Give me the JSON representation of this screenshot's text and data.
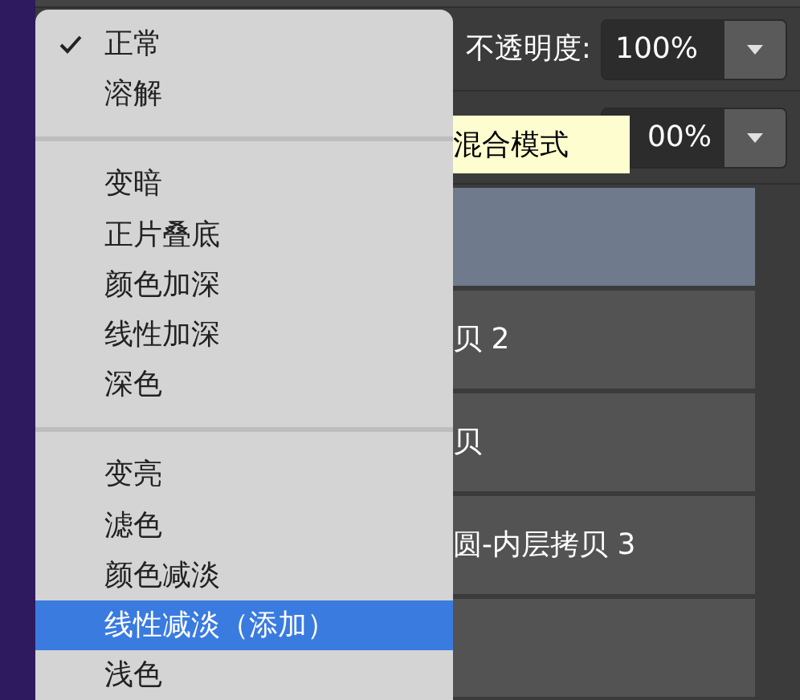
{
  "blend_menu": {
    "groups": [
      {
        "items": [
          {
            "label": "正常",
            "checked": true,
            "selected": false
          },
          {
            "label": "溶解",
            "checked": false,
            "selected": false
          }
        ]
      },
      {
        "items": [
          {
            "label": "变暗",
            "checked": false,
            "selected": false
          },
          {
            "label": "正片叠底",
            "checked": false,
            "selected": false
          },
          {
            "label": "颜色加深",
            "checked": false,
            "selected": false
          },
          {
            "label": "线性加深",
            "checked": false,
            "selected": false
          },
          {
            "label": "深色",
            "checked": false,
            "selected": false
          }
        ]
      },
      {
        "items": [
          {
            "label": "变亮",
            "checked": false,
            "selected": false
          },
          {
            "label": "滤色",
            "checked": false,
            "selected": false
          },
          {
            "label": "颜色减淡",
            "checked": false,
            "selected": false
          },
          {
            "label": "线性减淡（添加）",
            "checked": false,
            "selected": true
          },
          {
            "label": "浅色",
            "checked": false,
            "selected": false
          }
        ]
      }
    ]
  },
  "opacity": {
    "label": "不透明度:",
    "value": "100%"
  },
  "tooltip": "混合模式",
  "fill": {
    "value": "00%"
  },
  "layers": [
    {
      "selected": true
    },
    {
      "name": "贝 2",
      "selected": false
    },
    {
      "name": "贝",
      "selected": false
    },
    {
      "name": "圆-内层拷贝 3",
      "selected": false
    },
    {
      "selected": false
    }
  ]
}
